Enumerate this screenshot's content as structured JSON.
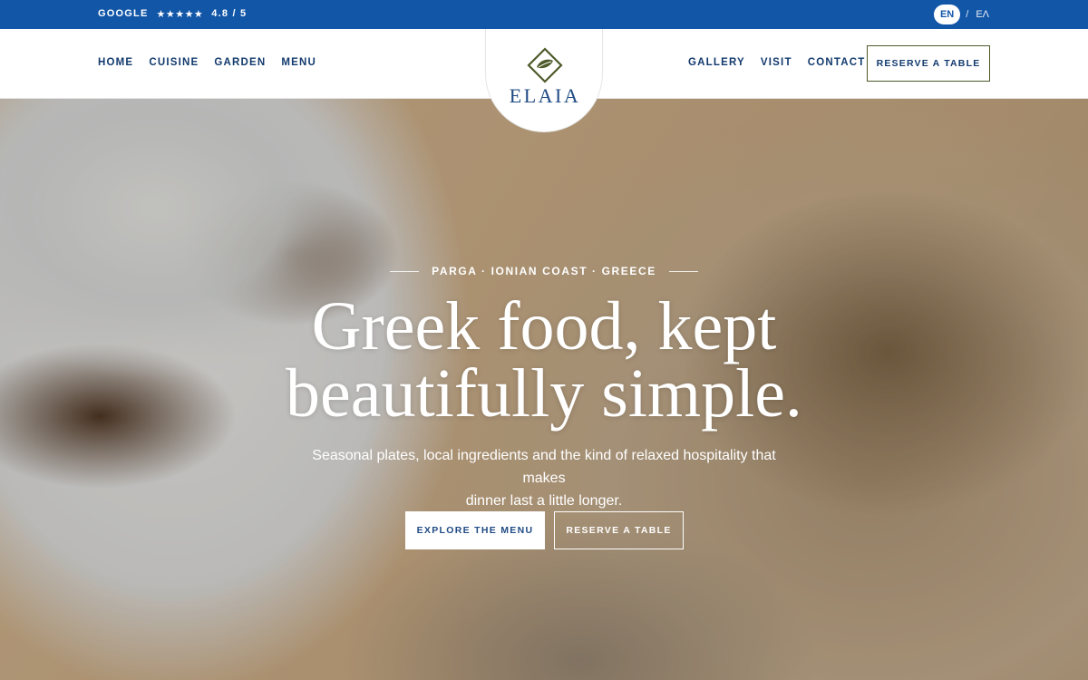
{
  "topbar": {
    "rating_source": "GOOGLE",
    "stars": "★★★★★",
    "rating": "4.8 / 5",
    "languages": {
      "active": "EN",
      "separator": "/",
      "other": "ΕΛ"
    },
    "background_color": "#1256a8"
  },
  "nav": {
    "left": [
      "HOME",
      "CUISINE",
      "GARDEN",
      "MENU"
    ],
    "right": [
      "GALLERY",
      "VISIT",
      "CONTACT"
    ],
    "reserve_button": "RESERVE A TABLE"
  },
  "logo": {
    "name": "ELAIA",
    "icon": "olive-leaf-diamond-icon",
    "accent_color": "#4d5a2a"
  },
  "hero": {
    "kicker": "PARGA · IONIAN COAST · GREECE",
    "headline_line1": "Greek food, kept",
    "headline_line2": "beautifully simple.",
    "subtitle_line1": "Seasonal plates, local ingredients and the kind of relaxed hospitality that makes",
    "subtitle_line2": "dinner last a little longer.",
    "primary_button": "EXPLORE THE MENU",
    "secondary_button": "RESERVE A TABLE",
    "background_image": "grilled-octopus-and-fava-photo"
  }
}
